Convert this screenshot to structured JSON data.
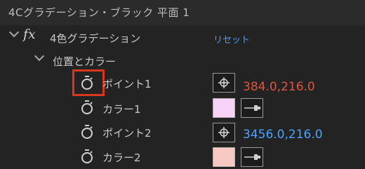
{
  "panel": {
    "title": "4Cグラデーション・ブラック 平面 1"
  },
  "effect": {
    "fx_label": "fx",
    "name": "4色グラデーション",
    "reset_label": "リセット"
  },
  "group": {
    "name": "位置とカラー"
  },
  "properties": [
    {
      "label": "ポイント1",
      "value_x": "384.0",
      "value_sep": ",",
      "value_y": "216.0"
    },
    {
      "label": "カラー1",
      "swatch_color": "#f7d2f7"
    },
    {
      "label": "ポイント2",
      "value_x": "3456.0",
      "value_sep": ",",
      "value_y": "216.0"
    },
    {
      "label": "カラー2",
      "swatch_color": "#f7c9c3"
    }
  ],
  "icons": [
    "stopwatch-icon",
    "crosshair-icon",
    "eyedropper-icon",
    "chevron-down-icon"
  ],
  "colors": {
    "highlight_box": "#d8361f",
    "link_blue": "#4a9cff",
    "value_red": "#e0553e"
  }
}
